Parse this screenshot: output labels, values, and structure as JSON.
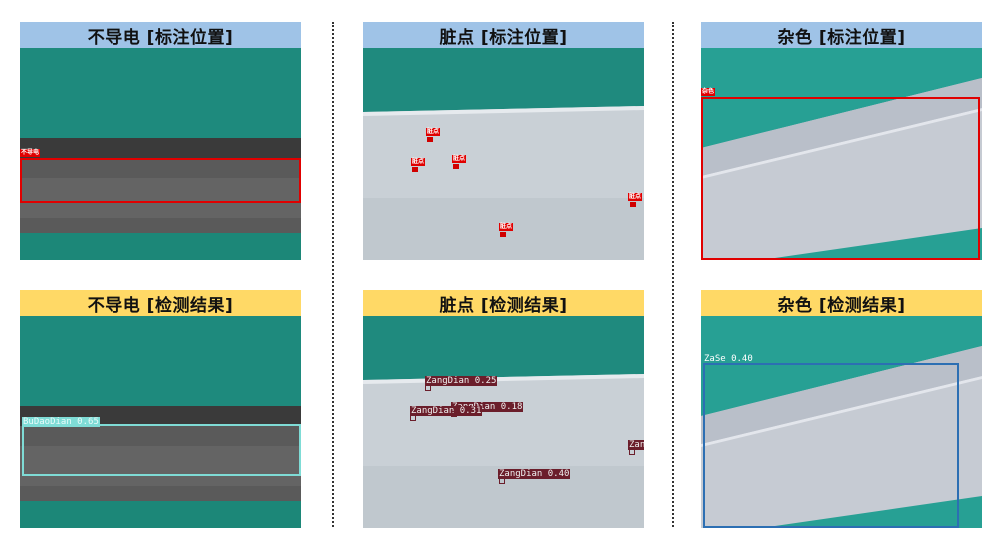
{
  "panels": {
    "p1_top": {
      "title": "不导电 [标注位置]",
      "labels": [
        "不导电"
      ]
    },
    "p2_top": {
      "title": "脏点 [标注位置]",
      "labels": [
        "脏点",
        "脏点",
        "脏点",
        "脏点",
        "脏点"
      ]
    },
    "p3_top": {
      "title": "杂色 [标注位置]",
      "labels": [
        "杂色"
      ]
    },
    "p1_bot": {
      "title": "不导电 [检测结果]",
      "detections": [
        "BuDaoDian 0.65"
      ]
    },
    "p2_bot": {
      "title": "脏点 [检测结果]",
      "detections": [
        "ZangDian 0.25",
        "ZangDian 0.31",
        "ZangDian 0.18",
        "Zan",
        "ZangDian 0.40"
      ]
    },
    "p3_bot": {
      "title": "杂色 [检测结果]",
      "detections": [
        "ZaSe 0.40"
      ]
    }
  },
  "colors": {
    "header_annotation": "#9fc3e7",
    "header_detection": "#ffd966",
    "annotation_box": "#e00000",
    "det_budaodian": "#7fdcd6",
    "det_zangdian": "#6b1e2b",
    "det_zase": "#2c6fb3",
    "background_teal": "#1f8a7e"
  }
}
